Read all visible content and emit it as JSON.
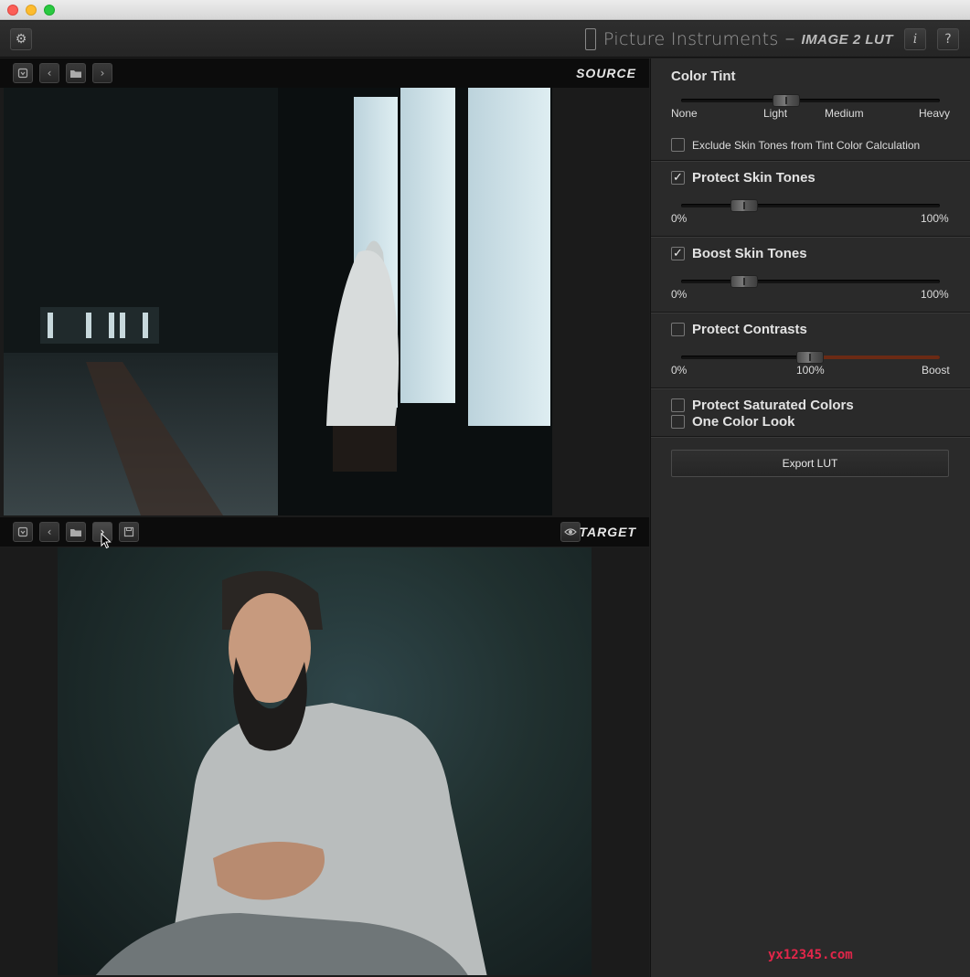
{
  "window": {
    "brand_name": "Picture Instruments",
    "brand_sep": "–",
    "product": "IMAGE 2 LUT",
    "info_label": "i",
    "help_label": "?"
  },
  "source": {
    "label": "SOURCE"
  },
  "target": {
    "label": "TARGET"
  },
  "icons": {
    "prev": "‹",
    "next": "›"
  },
  "color_tint": {
    "title": "Color Tint",
    "ticks": [
      "None",
      "Light",
      "Medium",
      "Heavy"
    ],
    "value_label": "Light",
    "exclude_skin_label": "Exclude Skin Tones from Tint Color Calculation",
    "exclude_skin_checked": false
  },
  "protect_skin": {
    "label": "Protect Skin Tones",
    "checked": true,
    "min_label": "0%",
    "max_label": "100%",
    "level": 0.25
  },
  "boost_skin": {
    "label": "Boost Skin Tones",
    "checked": true,
    "min_label": "0%",
    "max_label": "100%",
    "level": 0.25
  },
  "protect_contrasts": {
    "label": "Protect Contrasts",
    "checked": false,
    "min_label": "0%",
    "mid_label": "100%",
    "max_label": "Boost",
    "level": 0.5
  },
  "protect_saturated": {
    "label": "Protect Saturated Colors",
    "checked": false
  },
  "one_color_look": {
    "label": "One Color Look",
    "checked": false
  },
  "export": {
    "label": "Export LUT"
  },
  "watermark": "yx12345.com",
  "colors": {
    "accent_fill": "#6b2a14",
    "panel_bg": "#2a2a2a"
  }
}
